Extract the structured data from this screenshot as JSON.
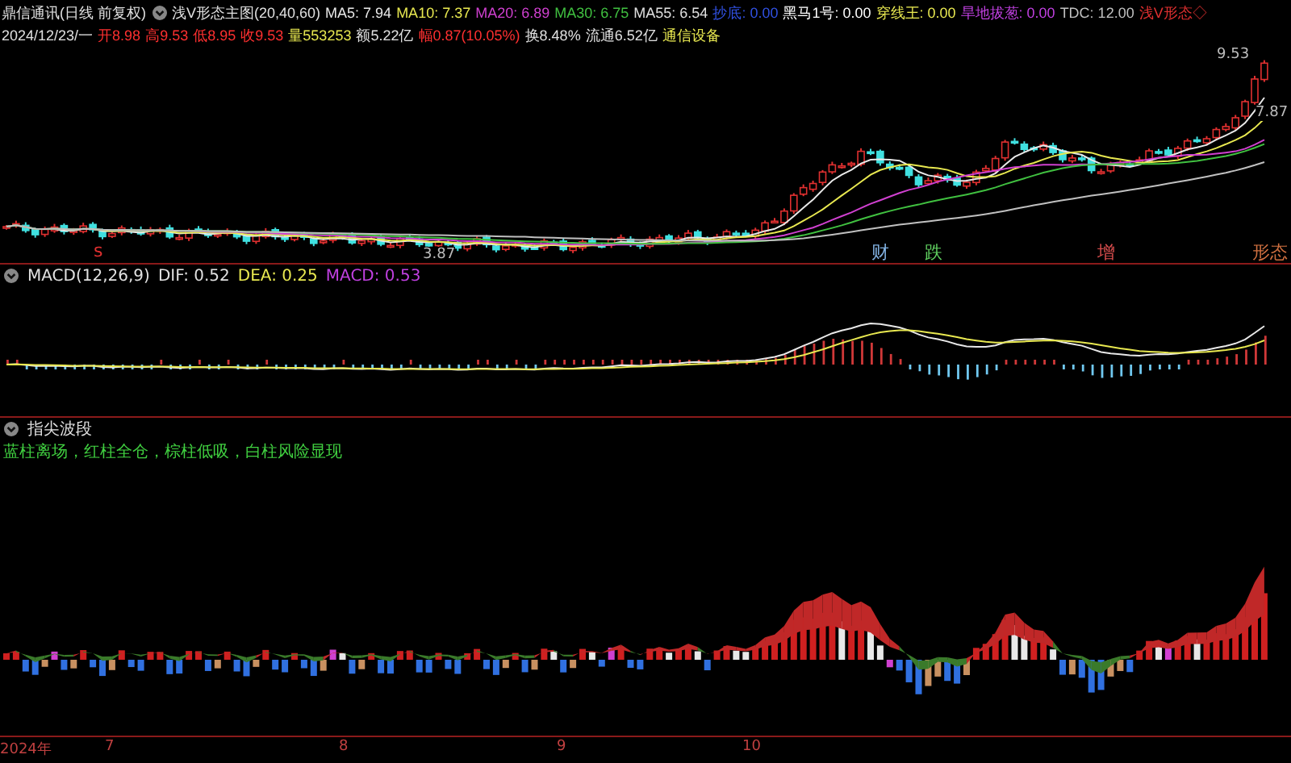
{
  "header": {
    "stock": "鼎信通讯(日线 前复权)",
    "indicator": "浅V形态主图(20,40,60)",
    "lines": [
      {
        "text": "MA5: 7.94",
        "color": "#e8e8e8"
      },
      {
        "text": "MA10: 7.37",
        "color": "#e8e850"
      },
      {
        "text": "MA20: 6.89",
        "color": "#d040d0"
      },
      {
        "text": "MA30: 6.75",
        "color": "#40c040"
      },
      {
        "text": "MA55: 6.54",
        "color": "#e0e0e0"
      },
      {
        "text": "抄底: 0.00",
        "color": "#3050e0"
      },
      {
        "text": "黑马1号: 0.00",
        "color": "#ffffff"
      },
      {
        "text": "穿线王: 0.00",
        "color": "#e8e850"
      },
      {
        "text": "旱地拔葱: 0.00",
        "color": "#c040e0"
      },
      {
        "text": "TDC: 12.00",
        "color": "#c0c0c0"
      },
      {
        "text": "浅V形态◇",
        "color": "#e03030"
      }
    ]
  },
  "quote": {
    "date": "2024/12/23/一",
    "items": [
      {
        "text": "开8.98",
        "color": "#ff3030"
      },
      {
        "text": "高9.53",
        "color": "#ff3030"
      },
      {
        "text": "低8.95",
        "color": "#ff3030"
      },
      {
        "text": "收9.53",
        "color": "#ff3030"
      },
      {
        "text": "量553253",
        "color": "#e8e850"
      },
      {
        "text": "额5.22亿",
        "color": "#e0e0e0"
      },
      {
        "text": "幅0.87(10.05%)",
        "color": "#ff3030"
      },
      {
        "text": "换8.48%",
        "color": "#e0e0e0"
      },
      {
        "text": "流通6.52亿",
        "color": "#e0e0e0"
      },
      {
        "text": "通信设备",
        "color": "#e8e850"
      }
    ]
  },
  "main_chart": {
    "high_label": "9.53",
    "right_label": "7.87",
    "low_label": "3.87",
    "markers": [
      {
        "text": "s",
        "color": "#e03030"
      },
      {
        "text": "财",
        "color": "#80b0e0"
      },
      {
        "text": "跌",
        "color": "#60d060"
      },
      {
        "text": "增",
        "color": "#e05050"
      },
      {
        "text": "形态",
        "color": "#d07040"
      }
    ]
  },
  "macd": {
    "title": "MACD(12,26,9)",
    "values": [
      {
        "text": "DIF: 0.52",
        "color": "#e0e0e0"
      },
      {
        "text": "DEA: 0.25",
        "color": "#e8e850"
      },
      {
        "text": "MACD: 0.53",
        "color": "#c040e0"
      }
    ]
  },
  "wave_panel": {
    "title": "指尖波段",
    "legend": "蓝柱离场，红柱全仓，棕柱低吸，白柱风险显现"
  },
  "time_axis": [
    "2024年",
    "7",
    "8",
    "9",
    "10"
  ]
}
